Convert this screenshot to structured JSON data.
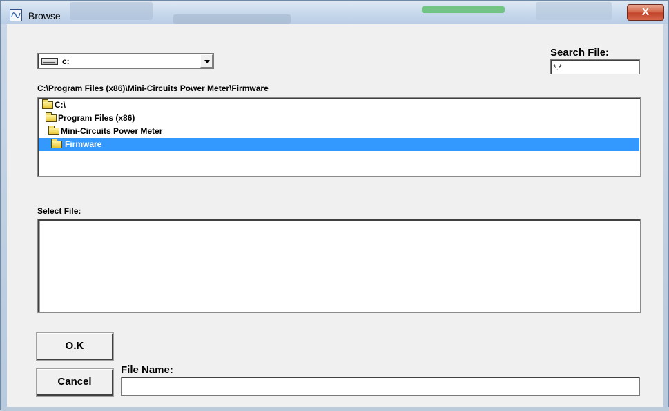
{
  "window": {
    "title": "Browse",
    "close_glyph": "X",
    "icon": "app-graph-icon"
  },
  "drive": {
    "selected": "c:",
    "icon": "drive-icon"
  },
  "search": {
    "label": "Search File:",
    "value": "*.*"
  },
  "current_path": "C:\\Program Files (x86)\\Mini-Circuits Power Meter\\Firmware",
  "folders": [
    {
      "label": "C:\\",
      "selected": false
    },
    {
      "label": "Program Files (x86)",
      "selected": false
    },
    {
      "label": "Mini-Circuits Power Meter",
      "selected": false
    },
    {
      "label": "Firmware",
      "selected": true
    }
  ],
  "select_file": {
    "label": "Select File:",
    "items": []
  },
  "buttons": {
    "ok": "O.K",
    "cancel": "Cancel"
  },
  "file_name": {
    "label": "File Name:",
    "value": ""
  },
  "colors": {
    "selection": "#3399ff",
    "client_bg": "#f0f0f0",
    "close_button": "#c2452b"
  }
}
